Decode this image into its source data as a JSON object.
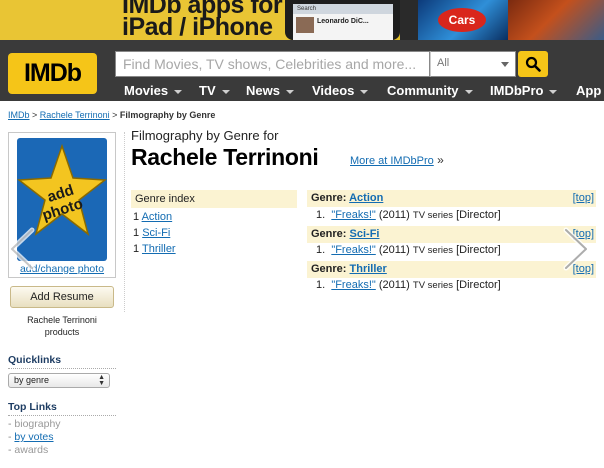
{
  "banner": {
    "line1": "IMDb apps for",
    "line2": "iPad / iPhone",
    "phone_search": "Search",
    "phone_name": "Leonardo DiC...",
    "tablet_logo": "Cars"
  },
  "header": {
    "logo": "IMDb",
    "search_placeholder": "Find Movies, TV shows, Celebrities and more...",
    "search_category": "All",
    "nav": [
      {
        "label": "Movies"
      },
      {
        "label": "TV"
      },
      {
        "label": "News"
      },
      {
        "label": "Videos"
      },
      {
        "label": "Community"
      },
      {
        "label": "IMDbPro"
      },
      {
        "label": "App"
      }
    ]
  },
  "breadcrumb": {
    "home": "IMDb",
    "sep1": " > ",
    "person": "Rachele Terrinoni",
    "sep2": " > ",
    "current": "Filmography by Genre"
  },
  "left": {
    "photo_text_1": "add",
    "photo_text_2": "photo",
    "photo_caption": "add/change photo",
    "add_resume": "Add Resume",
    "resume_caption_1": "Rachele Terrinoni",
    "resume_caption_2": "products",
    "quicklinks_title": "Quicklinks",
    "quicklinks_selected": "by genre",
    "toplinks_title": "Top Links",
    "toplinks": [
      {
        "prefix": "- ",
        "label": "biography"
      },
      {
        "prefix": "- ",
        "label": "by votes"
      },
      {
        "prefix": "- ",
        "label": "awards"
      }
    ]
  },
  "main": {
    "subtitle": "Filmography by Genre for",
    "title": "Rachele Terrinoni",
    "more_pro": "More at IMDbPro",
    "more_pro_suffix": " »",
    "genre_index_title": "Genre index",
    "genre_index": [
      {
        "count": "1",
        "label": "Action"
      },
      {
        "count": "1",
        "label": "Sci-Fi"
      },
      {
        "count": "1",
        "label": "Thriller"
      }
    ],
    "genre_prefix": "Genre: ",
    "top_label": "[top]",
    "genres": [
      {
        "name": "Action",
        "item_num": "1.",
        "title": "\"Freaks!\"",
        "year": "(2011)",
        "kind": "TV series",
        "role": "[Director]"
      },
      {
        "name": "Sci-Fi",
        "item_num": "1.",
        "title": "\"Freaks!\"",
        "year": "(2011)",
        "kind": "TV series",
        "role": "[Director]"
      },
      {
        "name": "Thriller",
        "item_num": "1.",
        "title": "\"Freaks!\"",
        "year": "(2011)",
        "kind": "TV series",
        "role": "[Director]"
      }
    ]
  },
  "colors": {
    "imdb_yellow": "#f5c518",
    "header_bg": "#3a3a3a",
    "link": "#136cb2",
    "section_bg": "#fbf3d2"
  }
}
